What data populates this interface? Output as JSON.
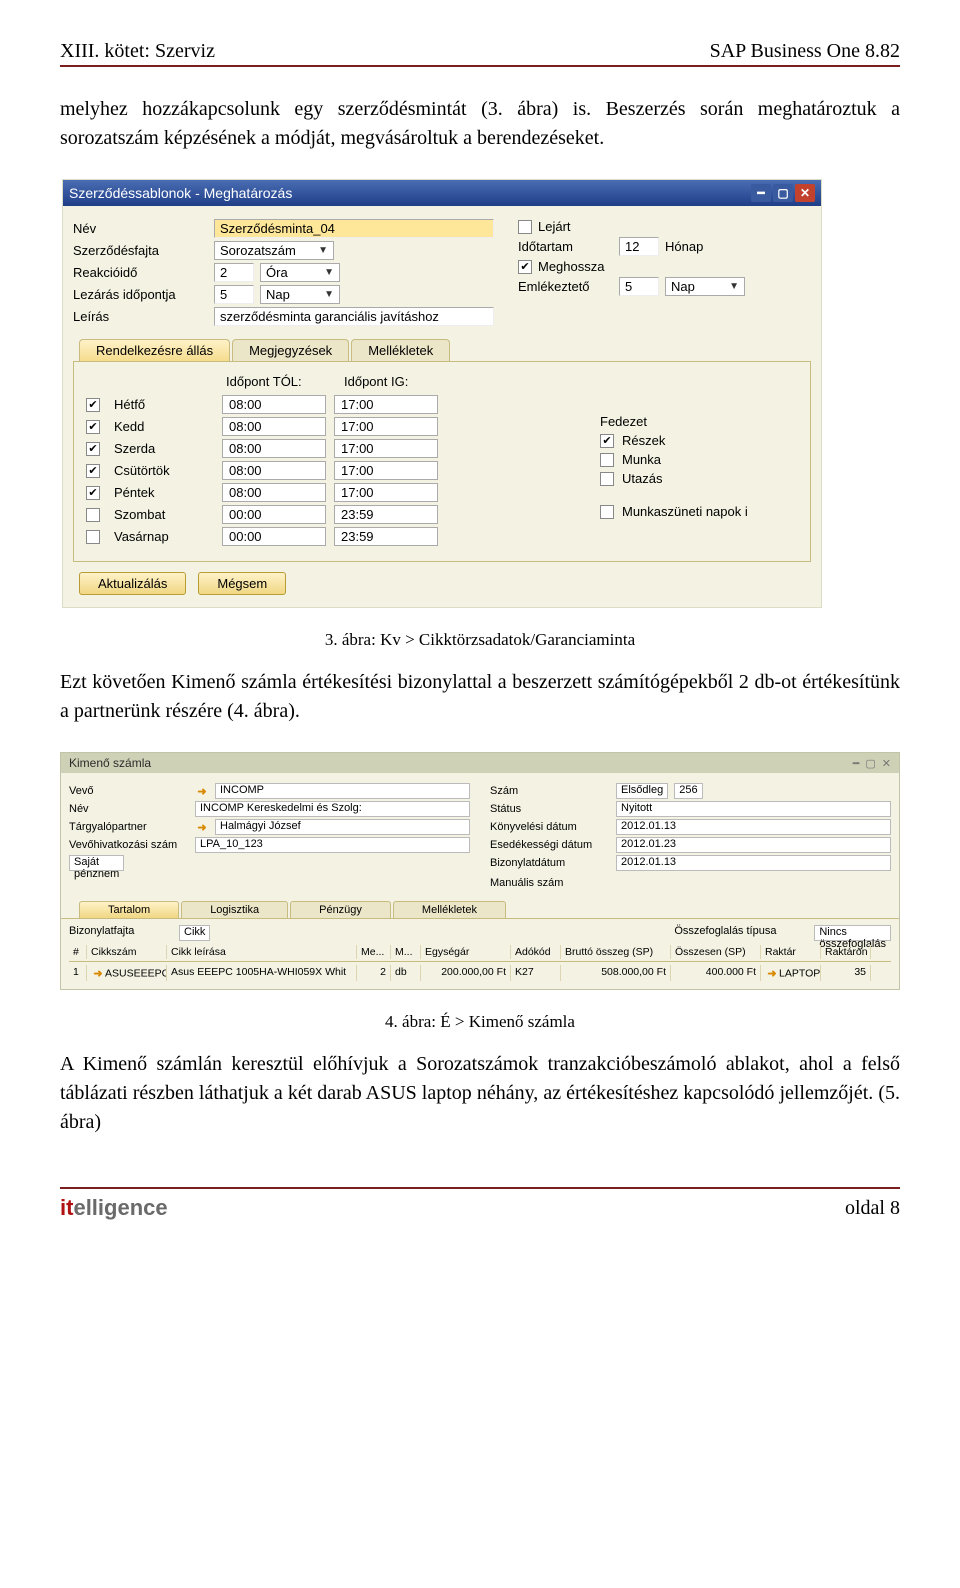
{
  "header": {
    "left": "XIII. kötet: Szerviz",
    "right": "SAP Business One 8.82"
  },
  "para1": "melyhez hozzákapcsolunk egy szerződésmintát (3. ábra) is. Beszerzés során meghatároztuk a sorozatszám képzésének a módját, megvásároltuk a berendezéseket.",
  "sap1": {
    "title": "Szerződéssablonok - Meghatározás",
    "labels": {
      "nev": "Név",
      "fajta": "Szerződésfajta",
      "reakcio": "Reakcióidő",
      "lezaras": "Lezárás időpontja",
      "leiras": "Leírás",
      "lejart": "Lejárt",
      "idotartam": "Időtartam",
      "meghossz": "Meghossza",
      "emlek": "Emlékeztető"
    },
    "values": {
      "nev": "Szerződésminta_04",
      "fajta": "Sorozatszám",
      "reakcio_num": "2",
      "reakcio_unit": "Óra",
      "lezaras_num": "5",
      "lezaras_unit": "Nap",
      "leiras": "szerződésminta garanciális javításhoz",
      "idotartam_num": "12",
      "idotartam_unit": "Hónap",
      "emlek_num": "5",
      "emlek_unit": "Nap"
    },
    "tabs": [
      "Rendelkezésre állás",
      "Megjegyzések",
      "Mellékletek"
    ],
    "time_headers": {
      "from": "Időpont TÓL:",
      "to": "Időpont IG:"
    },
    "days": [
      {
        "name": "Hétfő",
        "checked": true,
        "from": "08:00",
        "to": "17:00"
      },
      {
        "name": "Kedd",
        "checked": true,
        "from": "08:00",
        "to": "17:00"
      },
      {
        "name": "Szerda",
        "checked": true,
        "from": "08:00",
        "to": "17:00"
      },
      {
        "name": "Csütörtök",
        "checked": true,
        "from": "08:00",
        "to": "17:00"
      },
      {
        "name": "Péntek",
        "checked": true,
        "from": "08:00",
        "to": "17:00"
      },
      {
        "name": "Szombat",
        "checked": false,
        "from": "00:00",
        "to": "23:59"
      },
      {
        "name": "Vasárnap",
        "checked": false,
        "from": "00:00",
        "to": "23:59"
      }
    ],
    "coverage": {
      "title": "Fedezet",
      "items": [
        {
          "label": "Részek",
          "checked": true
        },
        {
          "label": "Munka",
          "checked": false
        },
        {
          "label": "Utazás",
          "checked": false
        }
      ],
      "holidays": {
        "label": "Munkaszüneti napok i",
        "checked": false
      }
    },
    "buttons": {
      "ok": "Aktualizálás",
      "cancel": "Mégsem"
    }
  },
  "caption1": "3. ábra: Kv > Cikktörzsadatok/Garanciaminta",
  "para2": "Ezt követően Kimenő számla értékesítési bizonylattal a beszerzett számítógépekből 2 db-ot értékesítünk a partnerünk részére (4. ábra).",
  "sap2": {
    "title": "Kimenő számla",
    "left": {
      "vevo_lbl": "Vevő",
      "vevo": "INCOMP",
      "nev_lbl": "Név",
      "nev": "INCOMP Kereskedelmi és Szolg:",
      "targy_lbl": "Tárgyalópartner",
      "targy": "Halmágyi József",
      "vref_lbl": "Vevőhivatkozási szám",
      "vref": "LPA_10_123",
      "penznem": "Saját pénznem"
    },
    "right": {
      "szam_lbl": "Szám",
      "szam_type": "Elsődleg",
      "szam": "256",
      "status_lbl": "Státus",
      "status": "Nyitott",
      "konyv_lbl": "Könyvelési dátum",
      "konyv": "2012.01.13",
      "esed_lbl": "Esedékességi dátum",
      "esed": "2012.01.23",
      "bizony_lbl": "Bizonylatdátum",
      "bizony": "2012.01.13",
      "manual_lbl": "Manuális szám"
    },
    "tabs": [
      "Tartalom",
      "Logisztika",
      "Pénzügy",
      "Mellékletek"
    ],
    "gridtop": {
      "fajta_lbl": "Bizonylatfajta",
      "fajta": "Cikk",
      "osszef_lbl": "Összefoglalás típusa",
      "osszef": "Nincs összefoglalás"
    },
    "cols": [
      "#",
      "Cikkszám",
      "Cikk leírása",
      "Me...",
      "M...",
      "Egységár",
      "Adókód",
      "Bruttó összeg (SP)",
      "Összesen (SP)",
      "Raktár",
      "Raktáron"
    ],
    "row": {
      "n": "1",
      "cikk": "ASUSEEEPC",
      "leiras": "Asus EEEPC 1005HA-WHI059X Whit",
      "menny": "2",
      "egys": "db",
      "ar": "200.000,00 Ft",
      "ado": "K27",
      "brutto": "508.000,00 Ft",
      "osszesen": "400.000 Ft",
      "raktar": "LAPTOP",
      "rakton": "35"
    }
  },
  "caption2": "4. ábra: É > Kimenő számla",
  "para3": "A Kimenő számlán keresztül előhívjuk a Sorozatszámok tranzakcióbeszámoló ablakot, ahol a felső táblázati részben láthatjuk a két darab ASUS laptop néhány, az értékesítéshez kapcsolódó jellemzőjét. (5. ábra)",
  "footer": {
    "logo_it": "it",
    "logo_rest": "elligence",
    "page": "oldal 8"
  }
}
